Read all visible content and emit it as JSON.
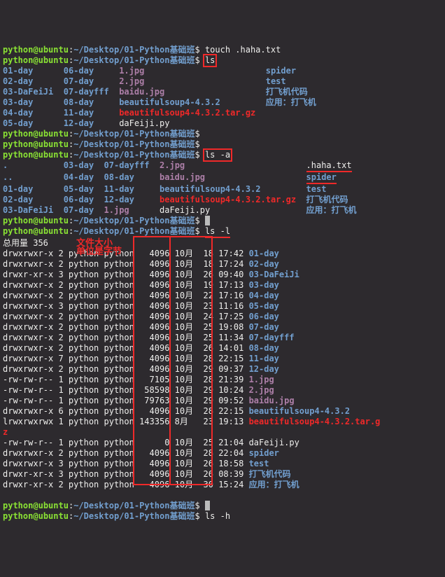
{
  "prompt": {
    "user": "python",
    "host": "ubuntu",
    "path": "~/Desktop/01-Python基础班",
    "sep": "$"
  },
  "cmd": {
    "touch": "touch .haha.txt",
    "ls": "ls",
    "ls_a": "ls -a",
    "ls_l": "ls -l",
    "ls_h": "ls -h"
  },
  "ls_out": {
    "r1": {
      "c1": "01-day",
      "c2": "06-day",
      "c3": "1.jpg",
      "c4": "",
      "c5": "",
      "c6": "spider"
    },
    "r2": {
      "c1": "02-day",
      "c2": "07-day",
      "c3": "2.jpg",
      "c4": "",
      "c5": "",
      "c6": "test"
    },
    "r3": {
      "c1": "03-DaFeiJi",
      "c2": "07-dayfff",
      "c3": "baidu.jpg",
      "c4": "",
      "c5": "",
      "c6": "打飞机代码"
    },
    "r4": {
      "c1": "03-day",
      "c2": "08-day",
      "c3": "beautifulsoup4-4.3.2",
      "c4": "",
      "c5": "",
      "c6": "应用：打飞机"
    },
    "r5": {
      "c1": "04-day",
      "c2": "11-day",
      "c3": "beautifulsoup4-4.3.2.tar.gz",
      "c4": "",
      "c5": "",
      "c6": ""
    },
    "r6": {
      "c1": "05-day",
      "c2": "12-day",
      "c3": "daFeiji.py",
      "c4": "",
      "c5": "",
      "c6": ""
    }
  },
  "lsa_out": {
    "r1": {
      "c1": ".",
      "c2": "03-day",
      "c3": "07-dayfff",
      "c4": "2.jpg",
      "c5": "",
      "c6": ".haha.txt"
    },
    "r2": {
      "c1": "..",
      "c2": "04-day",
      "c3": "08-day",
      "c4": "baidu.jpg",
      "c5": "",
      "c6": "spider"
    },
    "r3": {
      "c1": "01-day",
      "c2": "05-day",
      "c3": "11-day",
      "c4": "beautifulsoup4-4.3.2",
      "c5": "",
      "c6": "test"
    },
    "r4": {
      "c1": "02-day",
      "c2": "06-day",
      "c3": "12-day",
      "c4": "beautifulsoup4-4.3.2.tar.gz",
      "c5": "",
      "c6": "打飞机代码"
    },
    "r5": {
      "c1": "03-DaFeiJi",
      "c2": "07-day",
      "c3": "1.jpg",
      "c4": "daFeiji.py",
      "c5": "",
      "c6": "应用：打飞机"
    }
  },
  "lsl": {
    "total": "总用量 356",
    "annot1": "文件大小",
    "annot2": "单位是字节",
    "rows": [
      {
        "perm": "drwxrwxr-x",
        "n": "2",
        "u": "python",
        "g": "python",
        "sz": "4096",
        "m": "10月",
        "d": "18",
        "t": "17:42",
        "name": "01-day",
        "cls": "blue"
      },
      {
        "perm": "drwxrwxr-x",
        "n": "2",
        "u": "python",
        "g": "python",
        "sz": "4096",
        "m": "10月",
        "d": "18",
        "t": "17:24",
        "name": "02-day",
        "cls": "blue"
      },
      {
        "perm": "drwxr-xr-x",
        "n": "3",
        "u": "python",
        "g": "python",
        "sz": "4096",
        "m": "10月",
        "d": "26",
        "t": "09:40",
        "name": "03-DaFeiJi",
        "cls": "blue"
      },
      {
        "perm": "drwxrwxr-x",
        "n": "2",
        "u": "python",
        "g": "python",
        "sz": "4096",
        "m": "10月",
        "d": "19",
        "t": "17:13",
        "name": "03-day",
        "cls": "blue"
      },
      {
        "perm": "drwxrwxr-x",
        "n": "2",
        "u": "python",
        "g": "python",
        "sz": "4096",
        "m": "10月",
        "d": "22",
        "t": "17:16",
        "name": "04-day",
        "cls": "blue"
      },
      {
        "perm": "drwxrwxr-x",
        "n": "3",
        "u": "python",
        "g": "python",
        "sz": "4096",
        "m": "10月",
        "d": "23",
        "t": "11:16",
        "name": "05-day",
        "cls": "blue"
      },
      {
        "perm": "drwxrwxr-x",
        "n": "2",
        "u": "python",
        "g": "python",
        "sz": "4096",
        "m": "10月",
        "d": "24",
        "t": "17:25",
        "name": "06-day",
        "cls": "blue"
      },
      {
        "perm": "drwxrwxr-x",
        "n": "2",
        "u": "python",
        "g": "python",
        "sz": "4096",
        "m": "10月",
        "d": "25",
        "t": "19:08",
        "name": "07-day",
        "cls": "blue"
      },
      {
        "perm": "drwxrwxr-x",
        "n": "2",
        "u": "python",
        "g": "python",
        "sz": "4096",
        "m": "10月",
        "d": "25",
        "t": "11:34",
        "name": "07-dayfff",
        "cls": "blue"
      },
      {
        "perm": "drwxrwxr-x",
        "n": "2",
        "u": "python",
        "g": "python",
        "sz": "4096",
        "m": "10月",
        "d": "26",
        "t": "14:01",
        "name": "08-day",
        "cls": "blue"
      },
      {
        "perm": "drwxrwxr-x",
        "n": "7",
        "u": "python",
        "g": "python",
        "sz": "4096",
        "m": "10月",
        "d": "28",
        "t": "22:15",
        "name": "11-day",
        "cls": "blue"
      },
      {
        "perm": "drwxrwxr-x",
        "n": "2",
        "u": "python",
        "g": "python",
        "sz": "4096",
        "m": "10月",
        "d": "29",
        "t": "09:37",
        "name": "12-day",
        "cls": "blue"
      },
      {
        "perm": "-rw-rw-r--",
        "n": "1",
        "u": "python",
        "g": "python",
        "sz": "7105",
        "m": "10月",
        "d": "28",
        "t": "21:39",
        "name": "1.jpg",
        "cls": "magenta"
      },
      {
        "perm": "-rw-rw-r--",
        "n": "1",
        "u": "python",
        "g": "python",
        "sz": "58598",
        "m": "10月",
        "d": "29",
        "t": "10:24",
        "name": "2.jpg",
        "cls": "magenta"
      },
      {
        "perm": "-rw-rw-r--",
        "n": "1",
        "u": "python",
        "g": "python",
        "sz": "79763",
        "m": "10月",
        "d": "29",
        "t": "09:52",
        "name": "baidu.jpg",
        "cls": "magenta"
      },
      {
        "perm": "drwxrwxr-x",
        "n": "6",
        "u": "python",
        "g": "python",
        "sz": "4096",
        "m": "10月",
        "d": "28",
        "t": "22:15",
        "name": "beautifulsoup4-4.3.2",
        "cls": "blue"
      },
      {
        "perm": "lrwxrwxrwx",
        "n": "1",
        "u": "python",
        "g": "python",
        "sz": "143356",
        "m": "8月",
        "d": "23",
        "t": "19:13",
        "name": "beautifulsoup4-4.3.2.tar.g",
        "cls": "red"
      }
    ],
    "z": "z",
    "rows2": [
      {
        "perm": "-rw-rw-r--",
        "n": "1",
        "u": "python",
        "g": "python",
        "sz": "0",
        "m": "10月",
        "d": "25",
        "t": "21:04",
        "name": "daFeiji.py",
        "cls": "white"
      },
      {
        "perm": "drwxrwxr-x",
        "n": "2",
        "u": "python",
        "g": "python",
        "sz": "4096",
        "m": "10月",
        "d": "28",
        "t": "22:04",
        "name": "spider",
        "cls": "blue"
      },
      {
        "perm": "drwxrwxr-x",
        "n": "3",
        "u": "python",
        "g": "python",
        "sz": "4096",
        "m": "10月",
        "d": "26",
        "t": "18:58",
        "name": "test",
        "cls": "blue"
      },
      {
        "perm": "drwxr-xr-x",
        "n": "3",
        "u": "python",
        "g": "python",
        "sz": "4096",
        "m": "10月",
        "d": "26",
        "t": "08:39",
        "name": "打飞机代码",
        "cls": "blue"
      },
      {
        "perm": "drwxr-xr-x",
        "n": "2",
        "u": "python",
        "g": "python",
        "sz": "4096",
        "m": "10月",
        "d": "30",
        "t": "15:24",
        "name": "应用：打飞机",
        "cls": "blue"
      }
    ]
  },
  "cursor": " "
}
